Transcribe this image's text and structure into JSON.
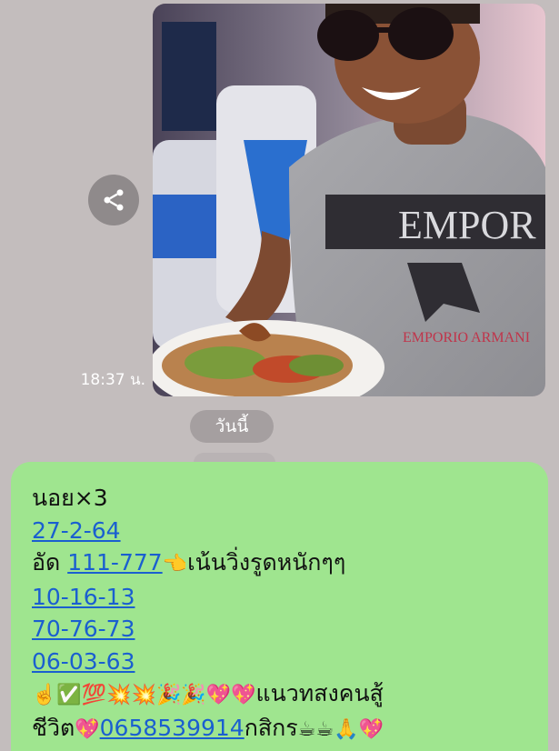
{
  "photo_message": {
    "timestamp": "18:37 น.",
    "shirt_text_top": "EMPOR",
    "shirt_text_bottom": "EMPORIO ARMANI"
  },
  "date_divider": {
    "label": "วันนี้"
  },
  "text_message": {
    "line1": "นอย×3",
    "line2_link": "27-2-64",
    "line3_prefix": "อัด ",
    "line3_link": "111-777",
    "line3_emoji": "👈",
    "line3_suffix": "เน้นวิ่งรูดหนักๆๆ",
    "line4_link": "10-16-13",
    "line5_link": "70-76-73",
    "line6_link": "06-03-63",
    "line7_emoji": "☝️✅💯💥💥🎉🎉💖💖",
    "line7_text": "แนวทสงคนสู้",
    "line8_prefix": "ชีวิต",
    "line8_emoji1": "💖",
    "line8_link": "0658539914",
    "line8_text": "กสิกร",
    "line8_emoji2": "☕☕🙏💖"
  },
  "icons": {
    "share": "share-icon"
  },
  "colors": {
    "background": "#c3bdbd",
    "message_bubble": "#9fe58f",
    "link": "#1a5fd0",
    "date_pill": "#a59fa0"
  }
}
